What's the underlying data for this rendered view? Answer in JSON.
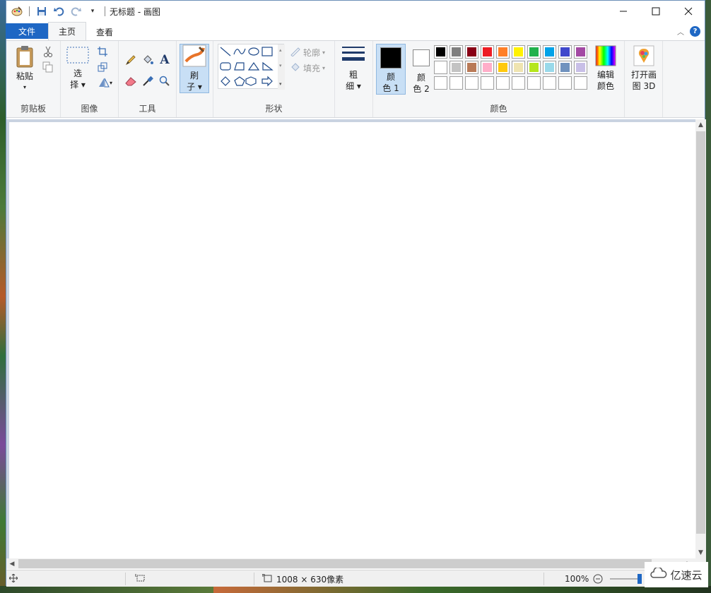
{
  "title_bar": {
    "window_title": "无标题 - 画图",
    "qat_icons": [
      "paint-app-icon",
      "save-icon",
      "undo-icon",
      "redo-icon",
      "customize-qat-icon"
    ],
    "controls": {
      "minimize": "—",
      "maximize": "☐",
      "close": "✕"
    }
  },
  "tabs": {
    "file": "文件",
    "home": "主页",
    "view": "查看"
  },
  "ribbon": {
    "clipboard": {
      "paste": "粘贴",
      "label": "剪贴板"
    },
    "image": {
      "select_line1": "选",
      "select_line2": "择",
      "label": "图像"
    },
    "tools": {
      "label": "工具"
    },
    "brushes": {
      "line1": "刷",
      "line2": "子"
    },
    "shapes": {
      "outline": "轮廓",
      "fill": "填充",
      "label": "形状"
    },
    "size": {
      "line1": "粗",
      "line2": "细"
    },
    "colors": {
      "color1_line1": "颜",
      "color1_line2": "色 1",
      "color2_line1": "颜",
      "color2_line2": "色 2",
      "edit_line1": "编辑",
      "edit_line2": "颜色",
      "label": "颜色",
      "color1": "#000000",
      "color2": "#ffffff",
      "palette_row1": [
        "#000000",
        "#7f7f7f",
        "#880015",
        "#ed1c24",
        "#ff7f27",
        "#fff200",
        "#22b14c",
        "#00a2e8",
        "#3f48cc",
        "#a349a4"
      ],
      "palette_row2": [
        "#ffffff",
        "#c3c3c3",
        "#b97a57",
        "#ffaec9",
        "#ffc90e",
        "#efe4b0",
        "#b5e61d",
        "#99d9ea",
        "#7092be",
        "#c8bfe7"
      ],
      "palette_row3": [
        "",
        "",
        "",
        "",
        "",
        "",
        "",
        "",
        "",
        ""
      ]
    },
    "paint3d": {
      "line1": "打开画",
      "line2": "图 3D"
    }
  },
  "status": {
    "canvas_size": "1008 × 630像素",
    "zoom": "100%"
  },
  "watermark": {
    "text": "亿速云"
  }
}
